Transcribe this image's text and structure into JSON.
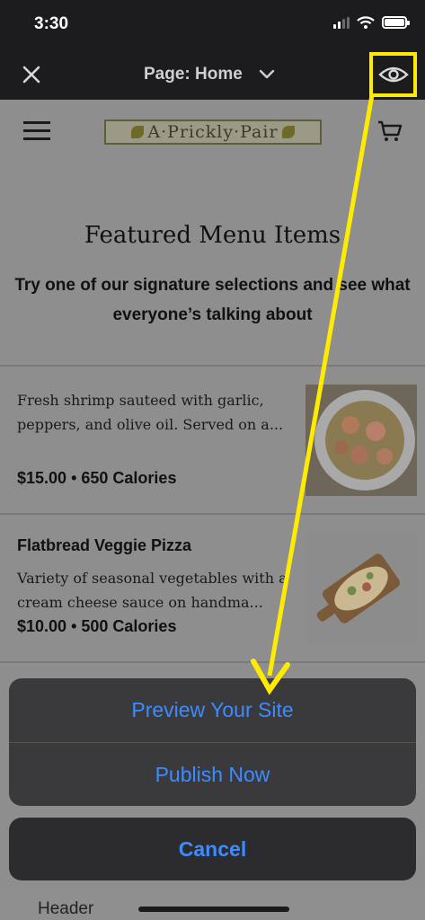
{
  "status_bar": {
    "time": "3:30"
  },
  "top_bar": {
    "page_selector": "Page: Home"
  },
  "site": {
    "logo_text": "A·Prickly·Pair",
    "section_title": "Featured Menu Items",
    "section_subtitle": "Try one of our signature selections and see what everyone’s talking about",
    "items": [
      {
        "name": "",
        "description": "Fresh shrimp sauteed with garlic, peppers, and olive oil. Served on a...",
        "price": "$15.00",
        "calories": "650 Calories"
      },
      {
        "name": "Flatbread Veggie Pizza",
        "description": "Variety of seasonal vegetables with a cream cheese sauce on handma...",
        "price": "$10.00",
        "calories": "500 Calories"
      }
    ]
  },
  "action_sheet": {
    "preview_label": "Preview Your Site",
    "publish_label": "Publish Now",
    "cancel_label": "Cancel"
  },
  "bottom_label": "Header",
  "colors": {
    "accent": "#3d8bff",
    "highlight": "#ffeb00"
  },
  "icons": [
    "close-icon",
    "chevron-down-icon",
    "eye-icon",
    "menu-icon",
    "cart-icon"
  ]
}
